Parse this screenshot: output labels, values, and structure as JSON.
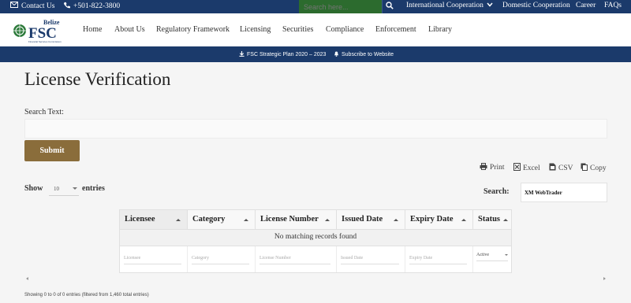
{
  "topbar": {
    "contact_label": "Contact Us",
    "phone": "+501-822-3800",
    "search_placeholder": "Search here...",
    "links": [
      "International Cooperation",
      "Domestic Cooperation",
      "Career",
      "FAQs"
    ]
  },
  "logo": {
    "small": "Belize",
    "main": "FSC",
    "tagline": "Financial Services Commission"
  },
  "nav": {
    "items": [
      "Home",
      "About Us",
      "Regulatory Framework",
      "Licensing",
      "Securities",
      "Compliance",
      "Enforcement",
      "Library"
    ]
  },
  "subbar": {
    "strategic_plan": "FSC Strategic Plan 2020 – 2023",
    "subscribe": "Subscribe to Website"
  },
  "page": {
    "title": "License Verification",
    "search_label": "Search Text:",
    "submit_label": "Submit"
  },
  "export": {
    "print": "Print",
    "excel": "Excel",
    "csv": "CSV",
    "copy": "Copy"
  },
  "length": {
    "show": "Show",
    "value": "10",
    "entries": "entries"
  },
  "search": {
    "label": "Search:",
    "value": "XM WebTrader"
  },
  "table": {
    "columns": [
      "Licensee",
      "Category",
      "License Number",
      "Issued Date",
      "Expiry Date",
      "Status"
    ],
    "empty_message": "No matching records found",
    "filters": [
      "Licensee",
      "Category",
      "License Number",
      "Issued Date",
      "Expiry Date"
    ],
    "status_filter": "Active"
  },
  "info": "Showing 0 to 0 of 0 entries (filtered from 1,460 total entries)",
  "colors": {
    "navy": "#1b3a6b",
    "green": "#2c6b2e",
    "gold": "#8a6d3b"
  }
}
